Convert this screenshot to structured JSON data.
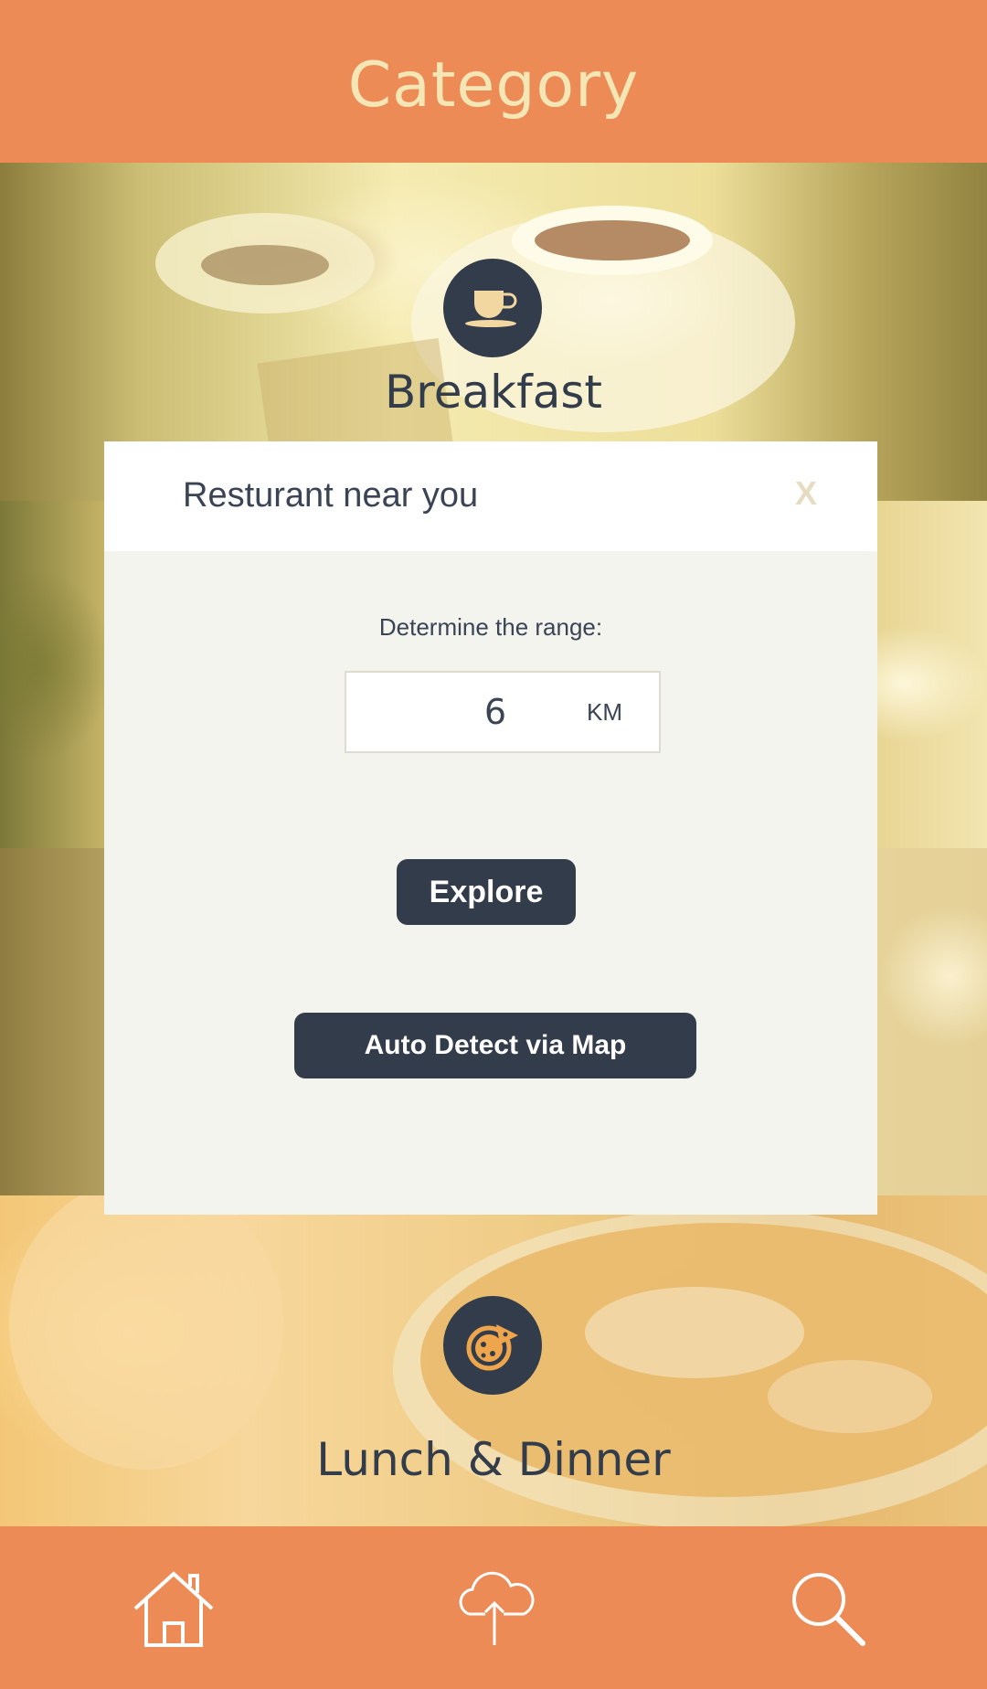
{
  "header": {
    "title": "Category"
  },
  "categories": [
    {
      "label": "Breakfast",
      "icon": "coffee-cup-icon"
    },
    {
      "label": "Lunch & Dinner",
      "icon": "pizza-icon"
    }
  ],
  "modal": {
    "title": "Resturant near you",
    "close_label": "X",
    "range_label": "Determine the range:",
    "range_value": "6",
    "range_unit": "KM",
    "explore_label": "Explore",
    "auto_detect_label": "Auto Detect via Map"
  },
  "nav": [
    {
      "name": "home",
      "icon": "home-icon"
    },
    {
      "name": "upload",
      "icon": "cloud-upload-icon"
    },
    {
      "name": "search",
      "icon": "search-icon"
    }
  ],
  "colors": {
    "bar": "#ed8b56",
    "title": "#f5e7b5",
    "dark": "#323c4b",
    "modal_bg": "#f4f4ee",
    "icon_accent": "#eea54b"
  }
}
